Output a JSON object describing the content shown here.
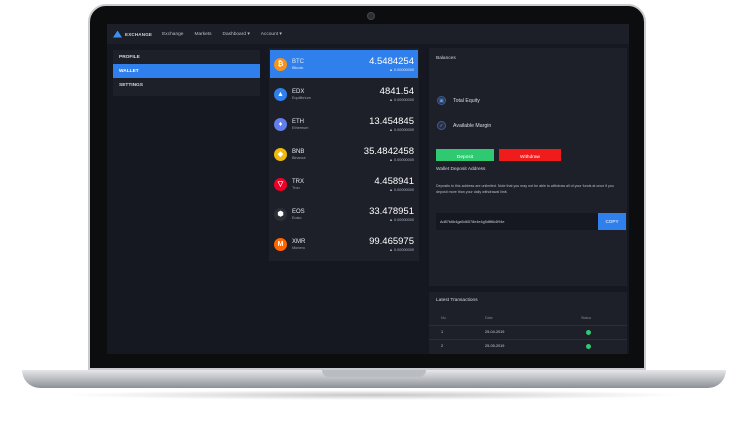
{
  "navbar": {
    "logo_text": "EXCHANGE",
    "links": [
      "Exchange",
      "Markets",
      "Dashboard ▾",
      "Account ▾"
    ]
  },
  "menu": {
    "items": [
      {
        "label": "PROFILE",
        "active": false
      },
      {
        "label": "WALLET",
        "active": true
      },
      {
        "label": "SETTINGS",
        "active": false
      }
    ]
  },
  "coins": [
    {
      "symbol": "BTC",
      "name": "Bitcoin",
      "amount": "4.5484254",
      "sub": "0.00000000",
      "color": "#f7931a",
      "glyph": "₿",
      "active": true
    },
    {
      "symbol": "EDX",
      "name": "Equilibrium",
      "amount": "4841.54",
      "sub": "0.00000000",
      "color": "#2f80ed",
      "glyph": "▲",
      "active": false
    },
    {
      "symbol": "ETH",
      "name": "Ethereum",
      "amount": "13.454845",
      "sub": "0.00000000",
      "color": "#627eea",
      "glyph": "♦",
      "active": false
    },
    {
      "symbol": "BNB",
      "name": "Binance",
      "amount": "35.4842458",
      "sub": "0.00000000",
      "color": "#f0b90b",
      "glyph": "◆",
      "active": false
    },
    {
      "symbol": "TRX",
      "name": "Tron",
      "amount": "4.458941",
      "sub": "0.00000000",
      "color": "#ef0027",
      "glyph": "▽",
      "active": false
    },
    {
      "symbol": "EOS",
      "name": "Eosio",
      "amount": "33.478951",
      "sub": "0.00000000",
      "color": "#2b2f38",
      "glyph": "⬢",
      "active": false
    },
    {
      "symbol": "XMR",
      "name": "Monero",
      "amount": "99.465975",
      "sub": "0.00000000",
      "color": "#ff6600",
      "glyph": "M",
      "active": false
    }
  ],
  "balances": {
    "title": "Balances",
    "total_equity": "Total Equity",
    "available_margin": "Available Margin",
    "deposit_label": "Deposit",
    "withdraw_label": "Withdraw"
  },
  "deposit": {
    "title": "Wallet Deposit Address",
    "note": "Deposits to this address are unlimited. Note that you may not be able to withdraw all of your funds at once if you deposit more than your daily withdrawal limit.",
    "address": "Ad87b6b4ga5d6578e4e4g5dff6k4f94e",
    "copy_label": "COPY"
  },
  "transactions": {
    "title": "Latest Transactions",
    "headers": [
      "No.",
      "Date",
      "Status"
    ],
    "rows": [
      {
        "no": "1",
        "date": "25-04-2019"
      },
      {
        "no": "2",
        "date": "25-05-2019"
      }
    ]
  }
}
